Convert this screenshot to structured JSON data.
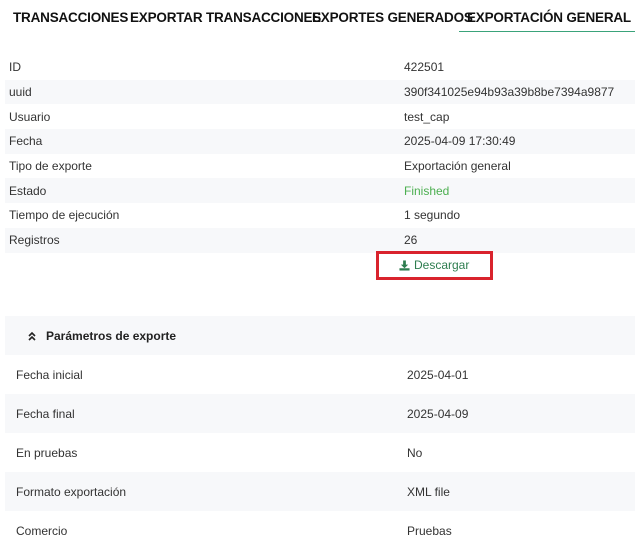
{
  "tabs": [
    {
      "label": "TRANSACCIONES"
    },
    {
      "label": "EXPORTAR TRANSACCIONES"
    },
    {
      "label": "EXPORTES GENERADOS"
    },
    {
      "label": "EXPORTACIÓN GENERAL",
      "active": true
    }
  ],
  "details": [
    {
      "key": "ID",
      "value": "422501"
    },
    {
      "key": "uuid",
      "value": "390f341025e94b93a39b8be7394a9877"
    },
    {
      "key": "Usuario",
      "value": "test_cap"
    },
    {
      "key": "Fecha",
      "value": "2025-04-09 17:30:49"
    },
    {
      "key": "Tipo de exporte",
      "value": "Exportación general"
    },
    {
      "key": "Estado",
      "value": "Finished"
    },
    {
      "key": "Tiempo de ejecución",
      "value": "1 segundo"
    },
    {
      "key": "Registros",
      "value": "26"
    }
  ],
  "download": {
    "label": "Descargar",
    "icon": "download-icon",
    "highlight_color": "#d9232d"
  },
  "params": {
    "title": "Parámetros de exporte",
    "icon": "chevron-double-up-icon",
    "rows": [
      {
        "key": "Fecha inicial",
        "value": "2025-04-01"
      },
      {
        "key": "Fecha final",
        "value": "2025-04-09"
      },
      {
        "key": "En pruebas",
        "value": "No"
      },
      {
        "key": "Formato exportación",
        "value": "XML file"
      },
      {
        "key": "Comercio",
        "value": "Pruebas"
      }
    ]
  },
  "colors": {
    "accent": "#3aa37a",
    "success": "#4caf50",
    "row_alt": "#f7f8fa"
  }
}
